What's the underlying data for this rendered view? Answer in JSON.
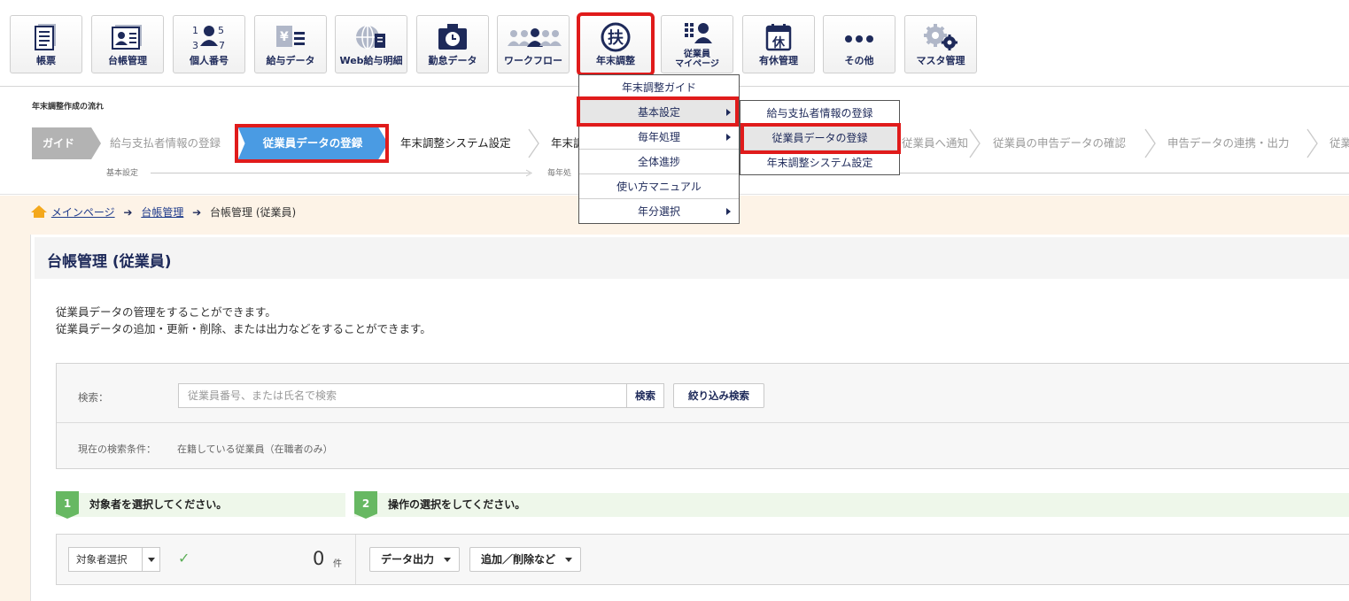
{
  "toolbar": {
    "buttons": [
      {
        "label": "帳票",
        "icon": "document-list-icon"
      },
      {
        "label": "台帳管理",
        "icon": "id-card-icon"
      },
      {
        "label": "個人番号",
        "icon": "person-number-icon"
      },
      {
        "label": "給与データ",
        "icon": "salary-data-icon"
      },
      {
        "label": "Web給与明細",
        "icon": "web-payslip-icon"
      },
      {
        "label": "勤怠データ",
        "icon": "attendance-clock-icon"
      },
      {
        "label": "ワークフロー",
        "icon": "workflow-people-icon"
      },
      {
        "label": "年末調整",
        "icon": "year-end-fu-icon",
        "glyph": "扶"
      },
      {
        "label_line1": "従業員",
        "label_line2": "マイページ",
        "icon": "employee-mypage-icon"
      },
      {
        "label": "有休管理",
        "icon": "paid-leave-calendar-icon",
        "glyph": "休"
      },
      {
        "label": "その他",
        "icon": "more-dots-icon"
      },
      {
        "label": "マスタ管理",
        "icon": "master-gears-icon"
      }
    ]
  },
  "flow": {
    "title": "年末調整作成の流れ",
    "guide": "ガイド",
    "steps": [
      "給与支払者情報の登録",
      "従業員データの登録",
      "年末調整システム設定",
      "年末調",
      "従業員へ通知",
      "従業員の申告データの確認",
      "申告データの連携・出力",
      "従業"
    ],
    "sub_labels": [
      "基本設定",
      "毎年処"
    ]
  },
  "menu": {
    "items": [
      "年末調整ガイド",
      "基本設定",
      "毎年処理",
      "全体進捗",
      "使い方マニュアル",
      "年分選択"
    ],
    "submenu": [
      "給与支払者情報の登録",
      "従業員データの登録",
      "年末調整システム設定"
    ]
  },
  "breadcrumb": {
    "home": "メインページ",
    "ledger": "台帳管理",
    "current": "台帳管理 (従業員)"
  },
  "main": {
    "title": "台帳管理 (従業員)",
    "desc1": "従業員データの管理をすることができます。",
    "desc2": "従業員データの追加・更新・削除、または出力などをすることができます。",
    "search": {
      "label": "検索：",
      "placeholder": "従業員番号、または氏名で検索",
      "button": "検索",
      "filter_button": "絞り込み検索",
      "condition_label": "現在の検索条件：",
      "condition_value": "在籍している従業員（在職者のみ）"
    },
    "step1": {
      "num": "1",
      "text": "対象者を選択してください。"
    },
    "step2": {
      "num": "2",
      "text": "操作の選択をしてください。"
    },
    "ops": {
      "select_label": "対象者選択",
      "count": "0",
      "unit": "件",
      "export_label": "データ出力",
      "add_delete_label": "追加／削除など"
    }
  },
  "colors": {
    "navy": "#1e2a5a",
    "active_step": "#4a9be3",
    "highlight": "#e01b1b",
    "step_green": "#67b862",
    "breadcrumb_bg": "#fdf3e7"
  }
}
